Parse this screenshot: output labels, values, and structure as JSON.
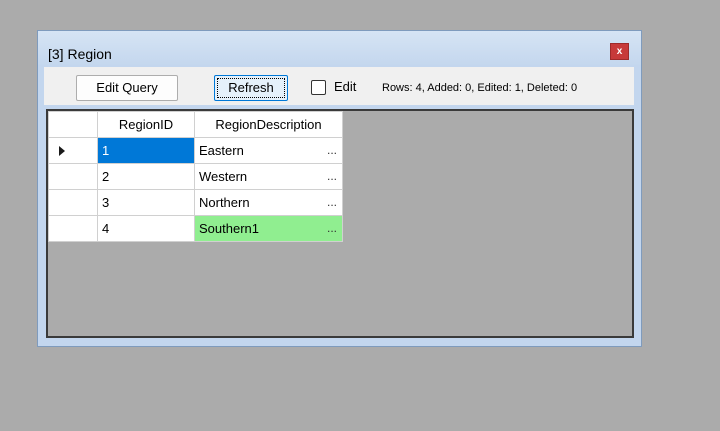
{
  "window": {
    "title": "[3] Region",
    "close_label": "x"
  },
  "toolbar": {
    "edit_query_label": "Edit Query",
    "refresh_label": "Refresh",
    "edit_label": "Edit",
    "edit_checked": false,
    "status": "Rows: 4, Added: 0, Edited: 1, Deleted: 0"
  },
  "grid": {
    "columns": [
      "RegionID",
      "RegionDescription"
    ],
    "cell_ellipsis": "...",
    "rows": [
      {
        "id": "1",
        "description": "Eastern",
        "current": true,
        "id_selected": true,
        "edited": false
      },
      {
        "id": "2",
        "description": "Western",
        "current": false,
        "id_selected": false,
        "edited": false
      },
      {
        "id": "3",
        "description": "Northern",
        "current": false,
        "id_selected": false,
        "edited": false
      },
      {
        "id": "4",
        "description": "Southern1",
        "current": false,
        "id_selected": false,
        "edited": true
      }
    ]
  },
  "colors": {
    "selection": "#0078d7",
    "edited_cell": "#90ee90",
    "desktop": "#ababab",
    "window_frame": "#c3d6ee",
    "close_button": "#c73a3a"
  }
}
